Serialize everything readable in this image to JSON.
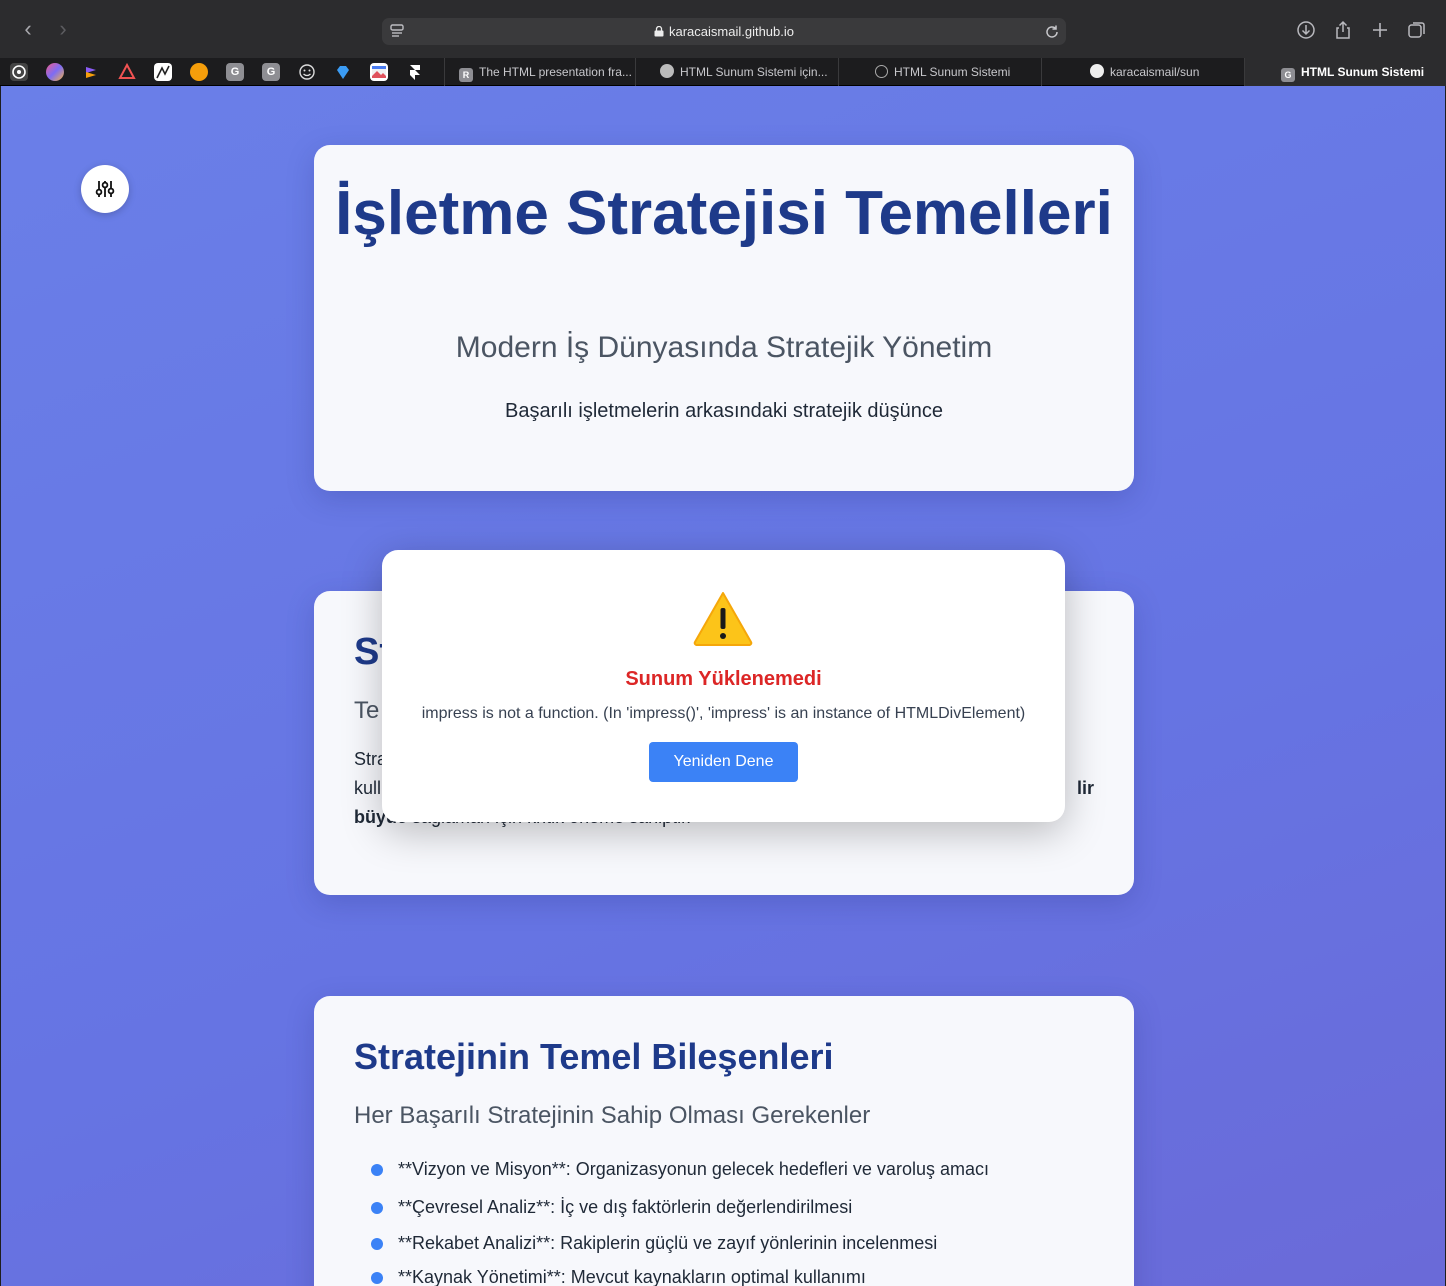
{
  "browser": {
    "url": "karacaismail.github.io",
    "tabs": [
      {
        "label": "The HTML presentation fra...",
        "favicon": "R"
      },
      {
        "label": "HTML Sunum Sistemi için...",
        "favicon": "openai"
      },
      {
        "label": "HTML Sunum Sistemi",
        "favicon": "compass"
      },
      {
        "label": "karacaismail/sun",
        "favicon": "github"
      },
      {
        "label": "HTML Sunum Sistemi",
        "favicon": "G",
        "active": true
      }
    ],
    "pinned_tab_letters": [
      "G",
      "G"
    ]
  },
  "slides": {
    "s1": {
      "title": "İşletme Stratejisi Temelleri",
      "subtitle": "Modern İş Dünyasında Stratejik Yönetim",
      "description": "Başarılı işletmelerin arkasındaki stratejik düşünce"
    },
    "s2": {
      "title_visible": "St",
      "subtitle_visible": "Te",
      "line1": "Stra",
      "line2_start": "kull",
      "line2_end": "lir",
      "line3_bold": "büyü",
      "line3_rest": "e sağlaman için kritik öneme sahiptir."
    },
    "s3": {
      "title": "Stratejinin Temel Bileşenleri",
      "subtitle": "Her Başarılı Stratejinin Sahip Olması Gerekenler",
      "items": [
        "**Vizyon ve Misyon**: Organizasyonun gelecek hedefleri ve varoluş amacı",
        "**Çevresel Analiz**: İç ve dış faktörlerin değerlendirilmesi",
        "**Rekabet Analizi**: Rakiplerin güçlü ve zayıf yönlerinin incelenmesi",
        "**Kaynak Yönetimi**: Mevcut kaynakların optimal kullanımı"
      ]
    }
  },
  "error_modal": {
    "title": "Sunum Yüklenemedi",
    "message": "impress is not a function. (In 'impress()', 'impress' is an instance of HTMLDivElement)",
    "retry_label": "Yeniden Dene"
  },
  "colors": {
    "page_bg": "#6a7fe8",
    "heading": "#1e3a8a",
    "error": "#dc2626",
    "button": "#3b82f6"
  }
}
